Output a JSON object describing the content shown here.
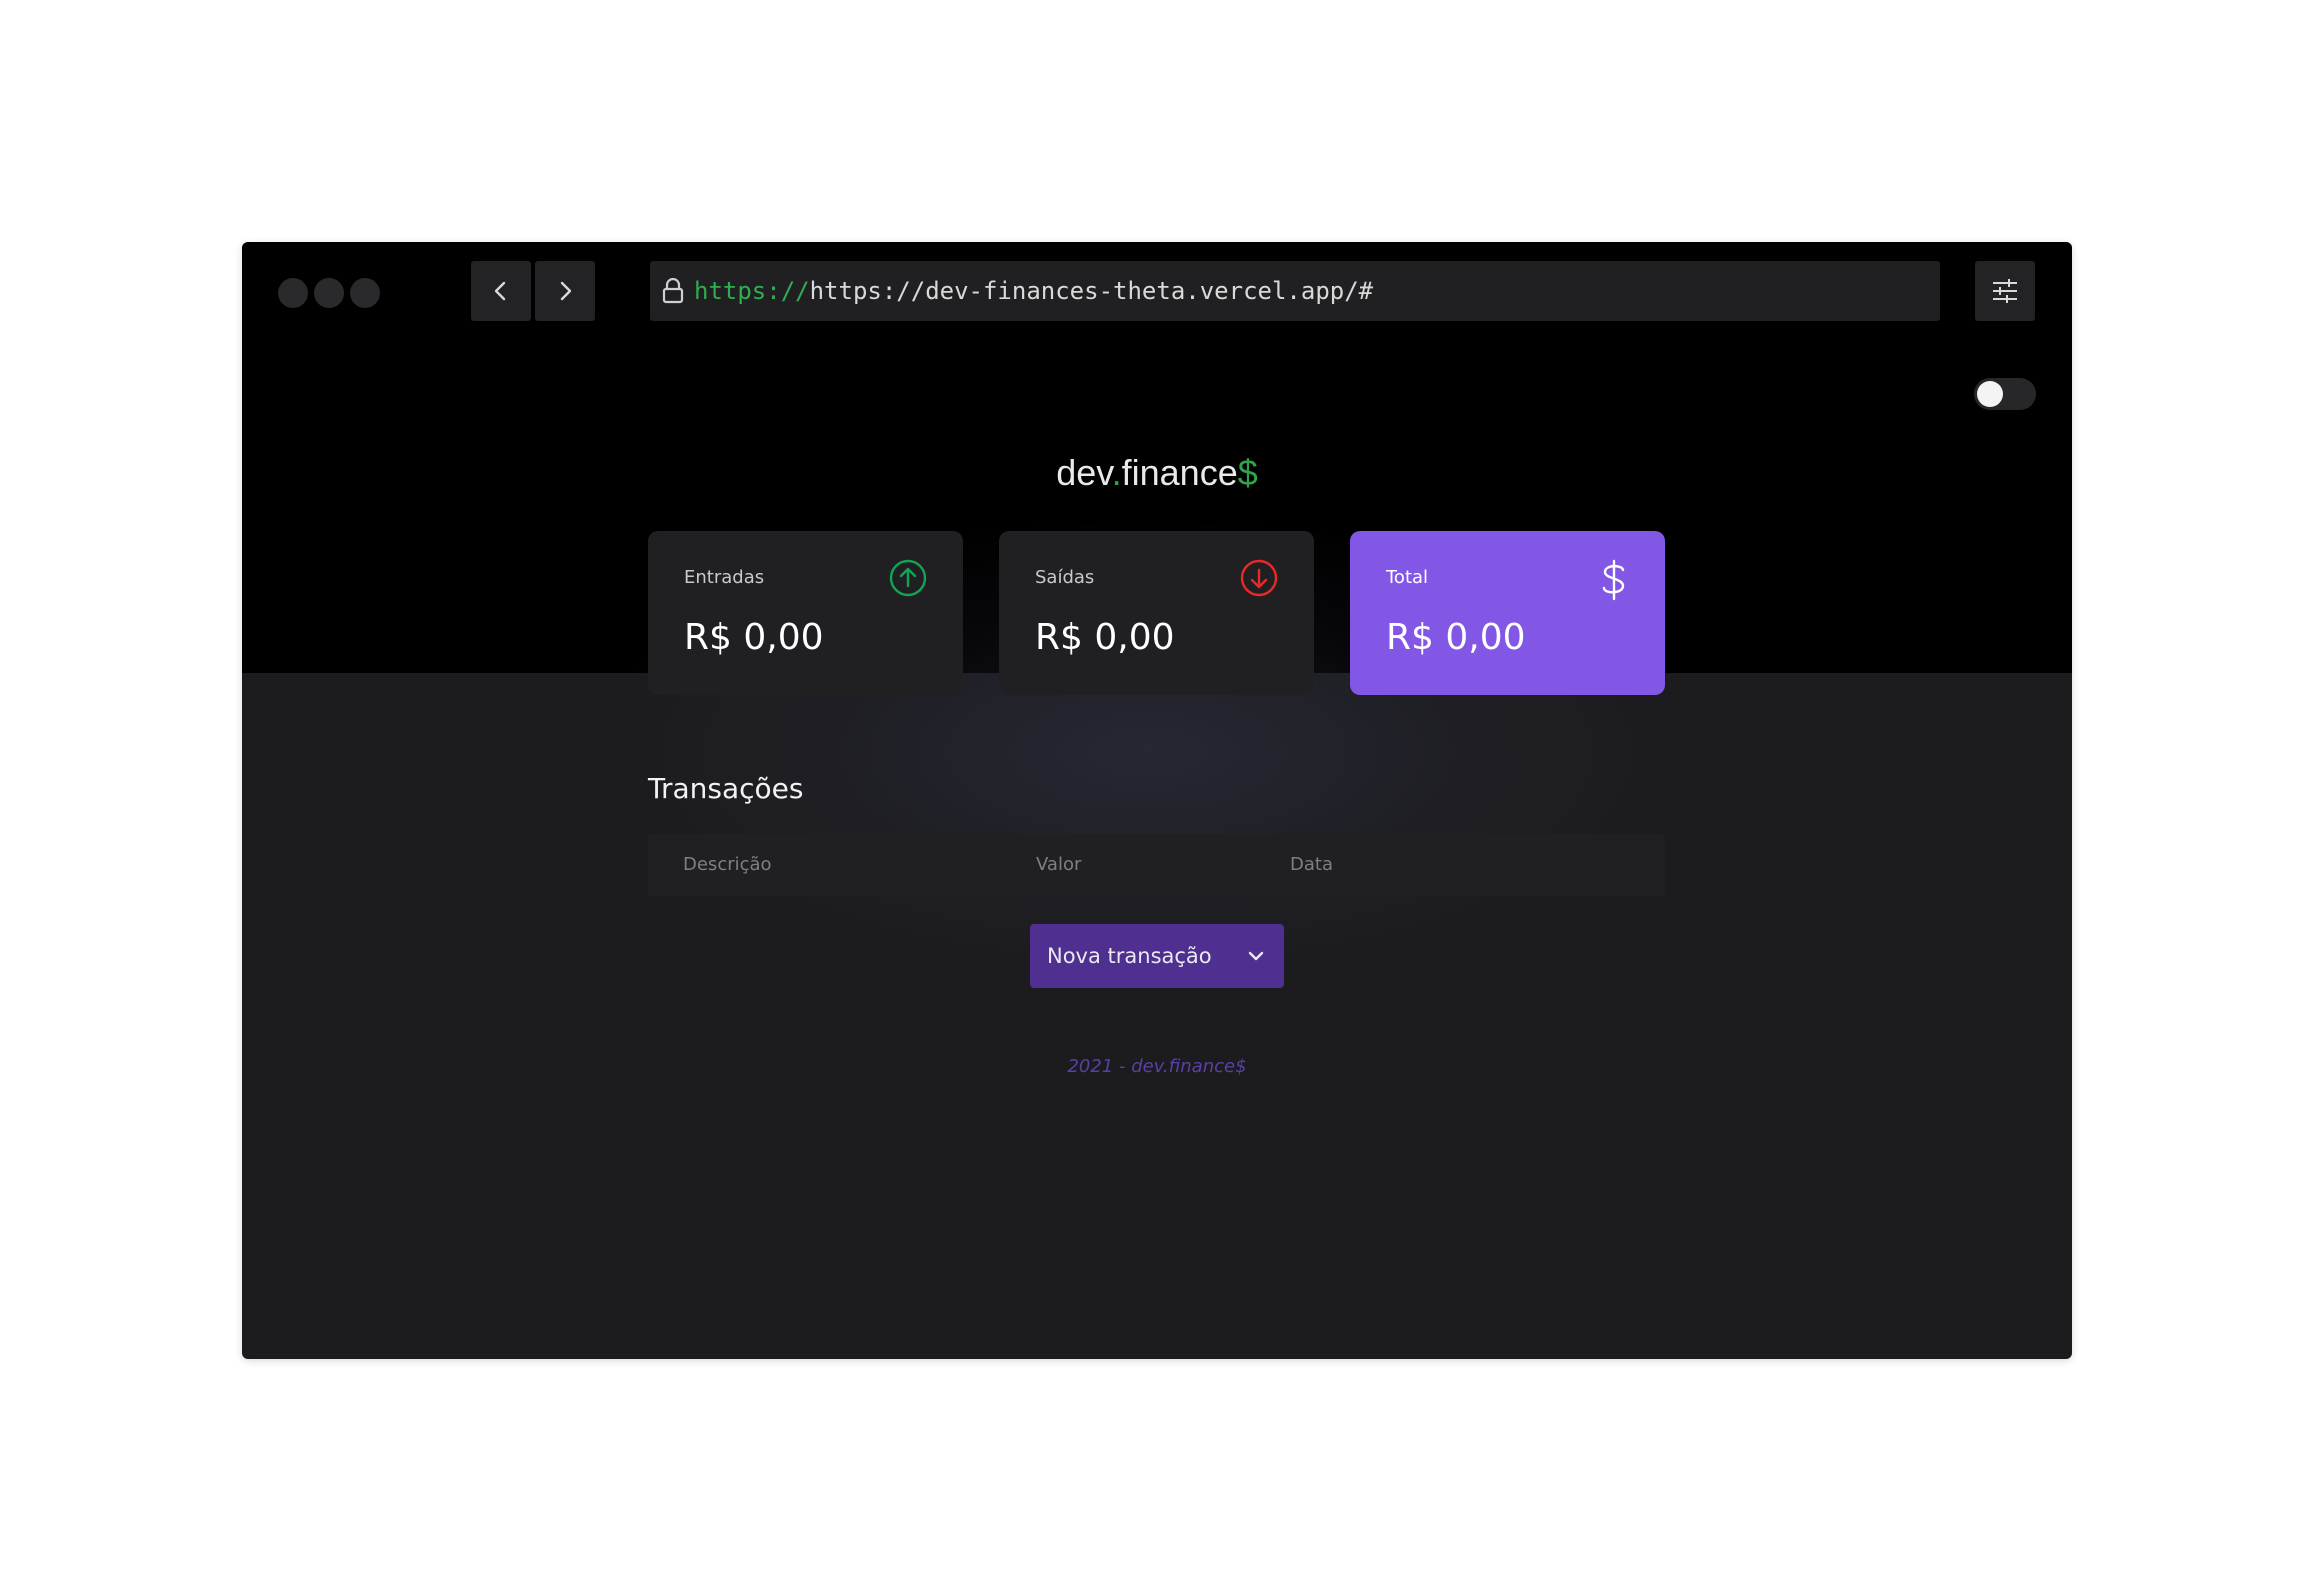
{
  "browser": {
    "url_scheme": "https://",
    "url_rest": "https://dev-finances-theta.vercel.app/#"
  },
  "app": {
    "logo_main": "dev",
    "logo_dot": ".",
    "logo_rest": "finance",
    "logo_symbol": "$"
  },
  "cards": [
    {
      "label": "Entradas",
      "value": "R$ 0,00",
      "icon": "arrow-up-circle-icon",
      "color": "#12a454"
    },
    {
      "label": "Saídas",
      "value": "R$ 0,00",
      "icon": "arrow-down-circle-icon",
      "color": "#e92929"
    },
    {
      "label": "Total",
      "value": "R$ 0,00",
      "icon": "dollar-icon",
      "color": "#ffffff"
    }
  ],
  "transactions": {
    "title": "Transações",
    "columns": [
      "Descrição",
      "Valor",
      "Data"
    ],
    "new_button": "Nova transação"
  },
  "footer": "2021 - dev.finance$",
  "colors": {
    "accent": "#8257e5",
    "positive": "#12a454",
    "negative": "#e92929"
  }
}
